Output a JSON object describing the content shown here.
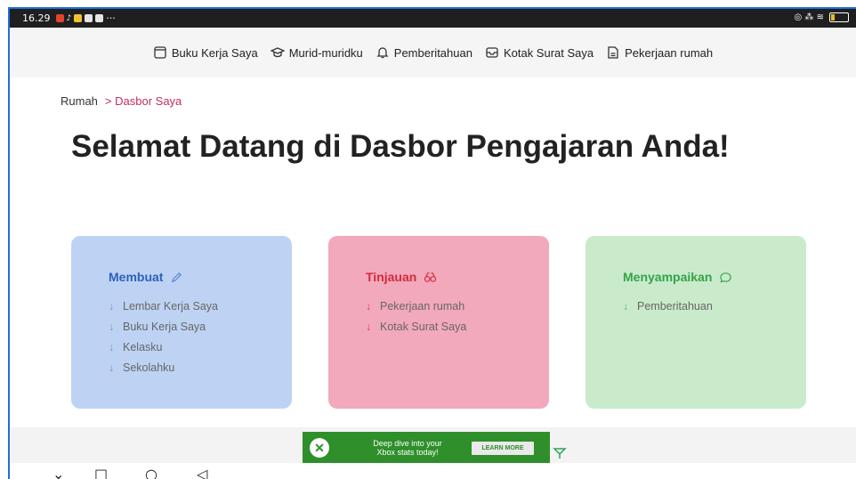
{
  "status_bar": {
    "time": "16.29",
    "more": "···",
    "right_icons": "◎ ⁂ ≋"
  },
  "top_nav": {
    "items": [
      {
        "label": "Buku Kerja Saya",
        "icon": "notebook-icon"
      },
      {
        "label": "Murid-muridku",
        "icon": "graduation-cap-icon"
      },
      {
        "label": "Pemberitahuan",
        "icon": "bell-icon"
      },
      {
        "label": "Kotak Surat Saya",
        "icon": "inbox-icon"
      },
      {
        "label": "Pekerjaan rumah",
        "icon": "document-icon"
      }
    ]
  },
  "breadcrumb": {
    "home": "Rumah",
    "separator": ">",
    "current": "Dasbor Saya"
  },
  "page_title": "Selamat Datang di Dasbor Pengajaran Anda!",
  "cards": [
    {
      "title": "Membuat",
      "icon": "pencil-icon",
      "color": "#2e5fbd",
      "background": "#bed3f3",
      "items": [
        "Lembar Kerja Saya",
        "Buku Kerja Saya",
        "Kelasku",
        "Sekolahku"
      ]
    },
    {
      "title": "Tinjauan",
      "icon": "binoculars-icon",
      "color": "#d42a3d",
      "background": "#f2a9bb",
      "items": [
        "Pekerjaan rumah",
        "Kotak Surat Saya"
      ]
    },
    {
      "title": "Menyampaikan",
      "icon": "speech-bubble-icon",
      "color": "#34a24a",
      "background": "#c9ebcb",
      "items": [
        "Pemberitahuan"
      ]
    }
  ],
  "ad": {
    "text": "Deep dive into your Xbox stats today!",
    "button": "LEARN MORE",
    "color": "#2e8f2b"
  },
  "android_nav": {
    "down": "⌄",
    "recents": "□",
    "home": "○",
    "back": "◁"
  }
}
